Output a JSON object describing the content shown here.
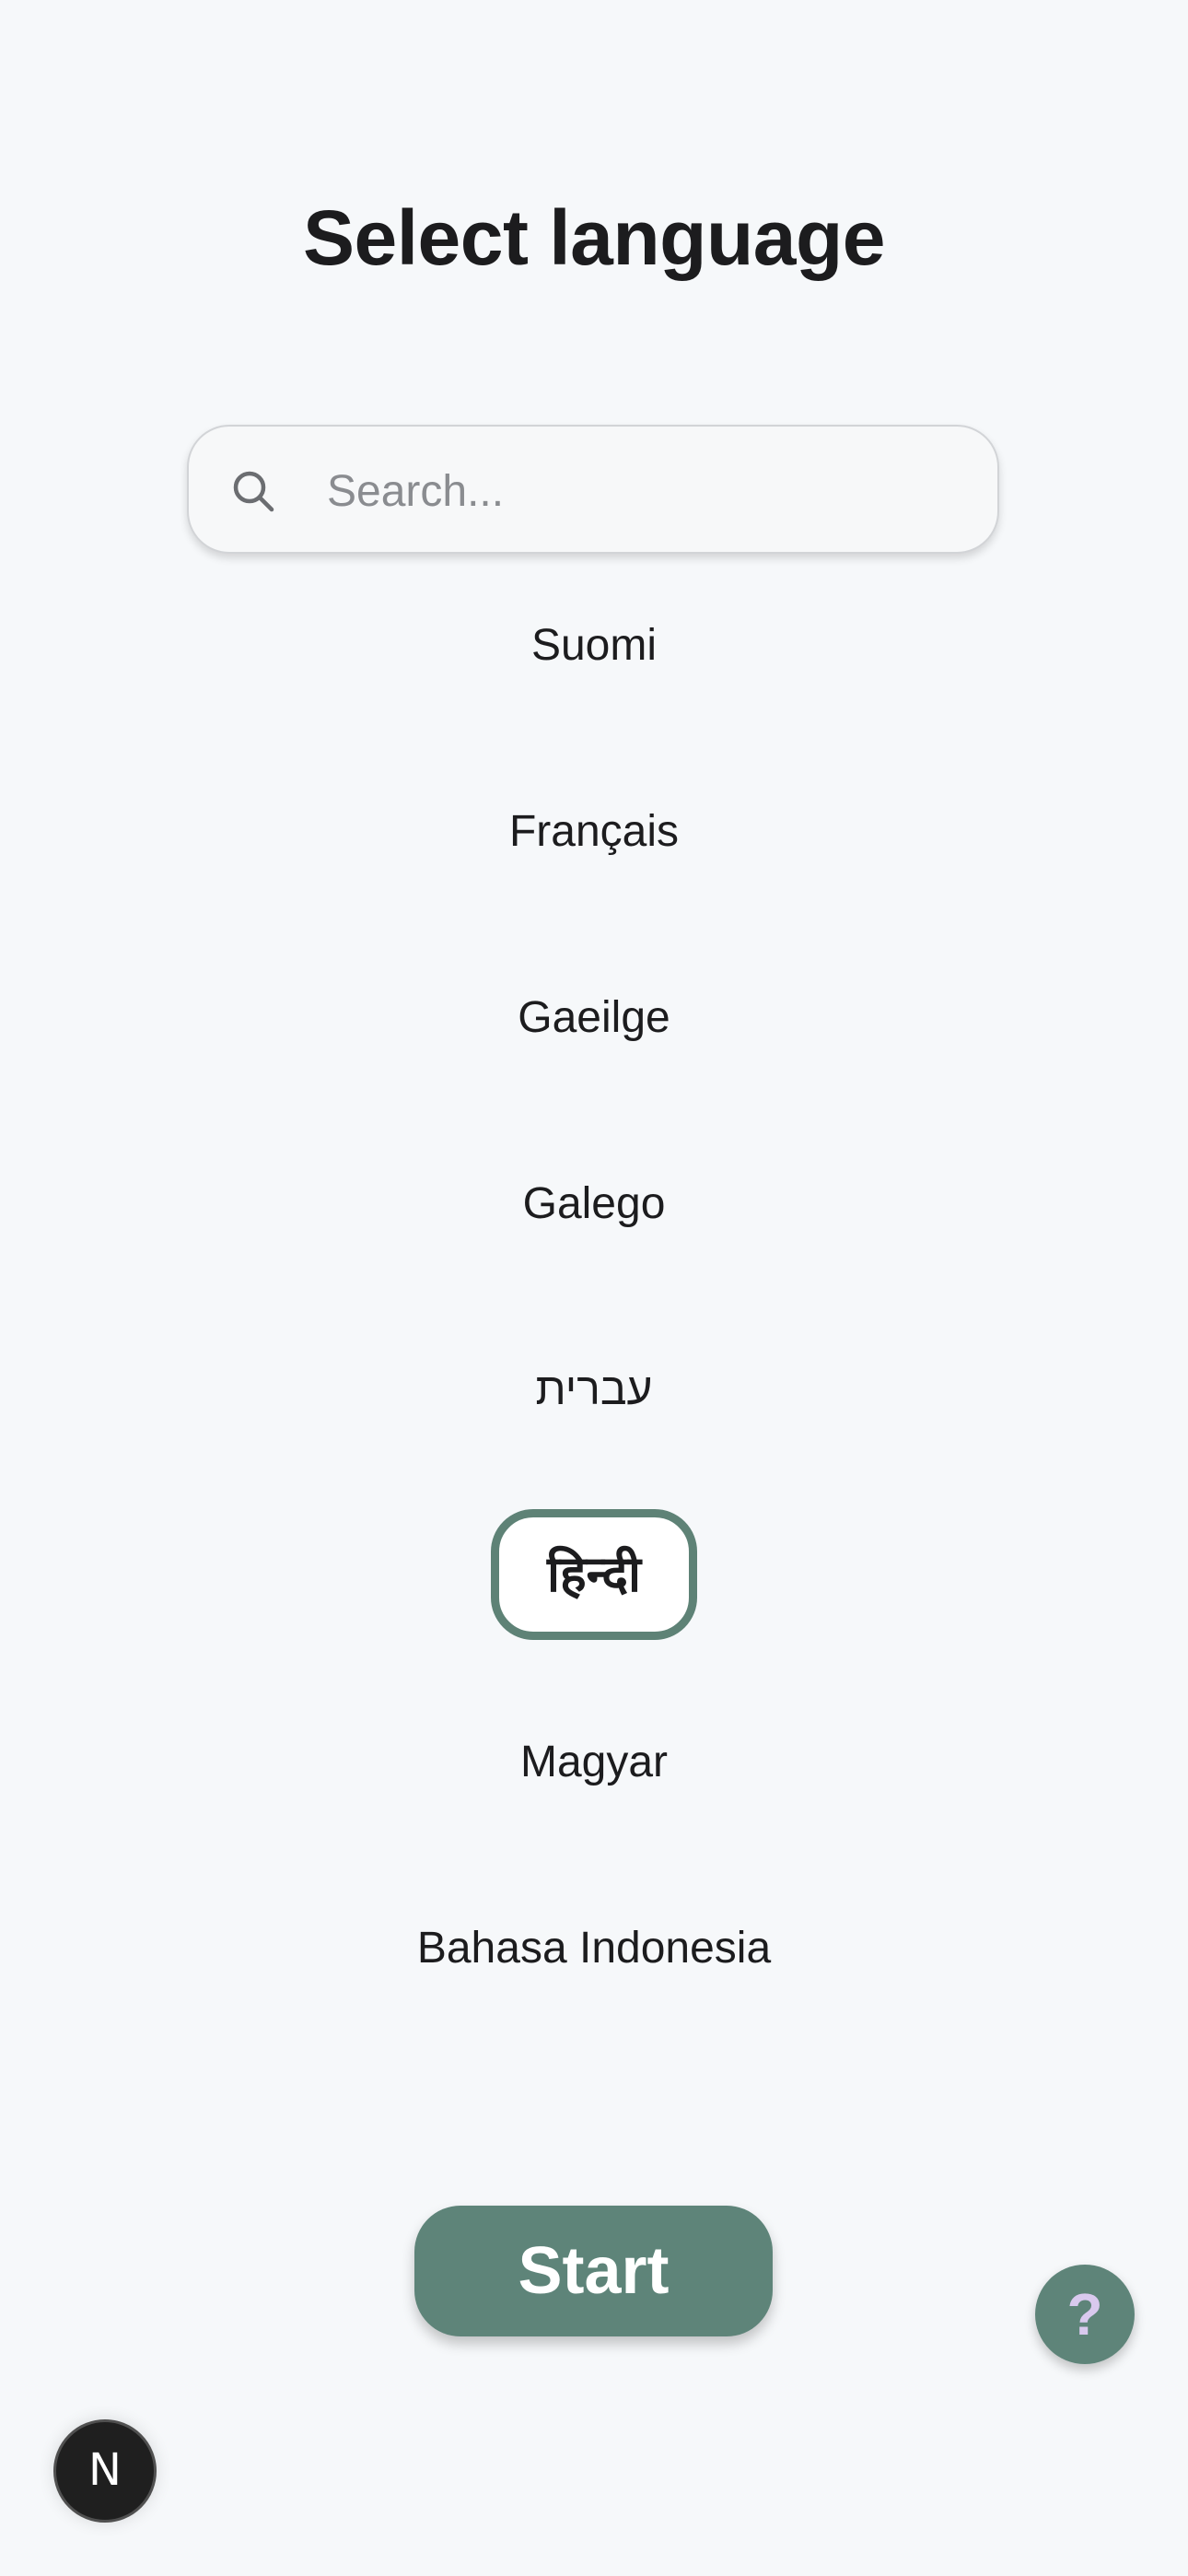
{
  "title": "Select language",
  "search": {
    "placeholder": "Search...",
    "value": "",
    "icon": "search-icon"
  },
  "languages": [
    {
      "label": "Suomi",
      "selected": false
    },
    {
      "label": "Français",
      "selected": false
    },
    {
      "label": "Gaeilge",
      "selected": false
    },
    {
      "label": "Galego",
      "selected": false
    },
    {
      "label": "עברית",
      "selected": false
    },
    {
      "label": "हिन्दी",
      "selected": true
    },
    {
      "label": "Magyar",
      "selected": false
    },
    {
      "label": "Bahasa Indonesia",
      "selected": false
    }
  ],
  "start_button": {
    "label": "Start"
  },
  "help_button": {
    "label": "?",
    "icon": "help-icon"
  },
  "dev_badge": {
    "label": "N",
    "icon": "next-logo-icon"
  },
  "colors": {
    "accent": "#5e8479",
    "background": "#f6f8fa",
    "text": "#1c1c1e",
    "help_glyph": "#d9c9ee"
  }
}
